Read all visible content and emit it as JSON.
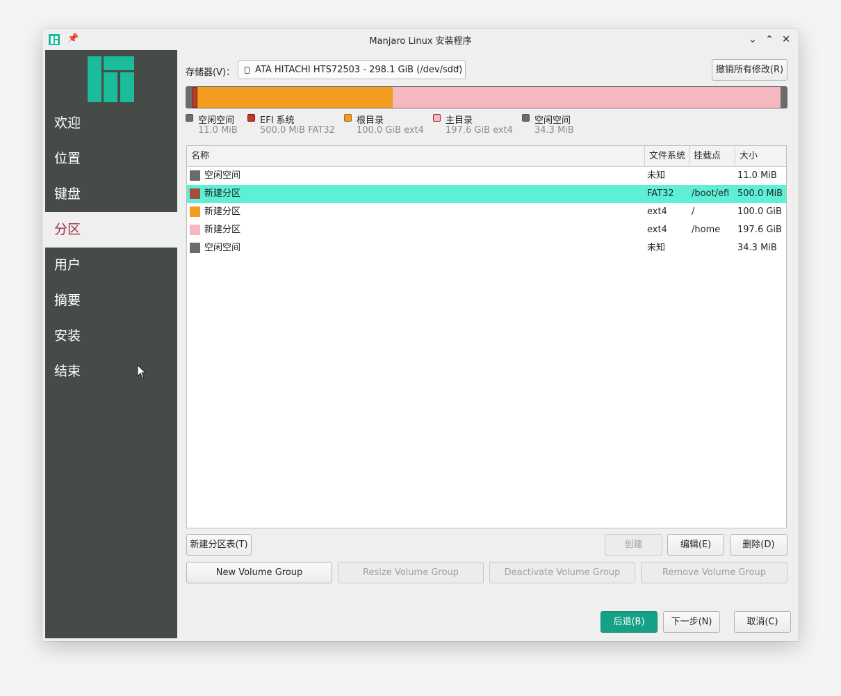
{
  "window": {
    "title": "Manjaro Linux 安装程序",
    "pin_icon": "pin-icon",
    "controls": [
      "minimize-icon",
      "maximize-icon",
      "close-icon"
    ]
  },
  "sidebar": {
    "items": [
      {
        "label": "欢迎"
      },
      {
        "label": "位置"
      },
      {
        "label": "键盘"
      },
      {
        "label": "分区",
        "active": true
      },
      {
        "label": "用户"
      },
      {
        "label": "摘要"
      },
      {
        "label": "安装"
      },
      {
        "label": "结束"
      }
    ]
  },
  "storage": {
    "label": "存储器(V)：",
    "device": "ATA HITACHI HTS72503 - 298.1 GiB (/dev/sdd)",
    "revert_button": "撤销所有修改(R)"
  },
  "legend": [
    {
      "name": "空闲空间",
      "size": "11.0 MiB",
      "fs": "",
      "color": "#6b6b6b"
    },
    {
      "name": "EFI 系统",
      "size": "500.0 MiB",
      "fs": "FAT32",
      "color": "#c0392b"
    },
    {
      "name": "根目录",
      "size": "100.0 GiB",
      "fs": "ext4",
      "color": "#f39c1f"
    },
    {
      "name": "主目录",
      "size": "197.6 GiB",
      "fs": "ext4",
      "color": "#f5b8bf"
    },
    {
      "name": "空闲空间",
      "size": "34.3 MiB",
      "fs": "",
      "color": "#6b6b6b"
    }
  ],
  "table": {
    "headers": {
      "name": "名称",
      "fs": "文件系统",
      "mount": "挂载点",
      "size": "大小"
    },
    "rows": [
      {
        "name": "空闲空间",
        "fs": "未知",
        "mount": "",
        "size": "11.0 MiB",
        "color": "#6b6b6b"
      },
      {
        "name": "新建分区",
        "fs": "FAT32",
        "mount": "/boot/efi",
        "size": "500.0 MiB",
        "color": "#a0503c",
        "selected": true
      },
      {
        "name": "新建分区",
        "fs": "ext4",
        "mount": "/",
        "size": "100.0 GiB",
        "color": "#f39c1f"
      },
      {
        "name": "新建分区",
        "fs": "ext4",
        "mount": "/home",
        "size": "197.6 GiB",
        "color": "#f5b8bf"
      },
      {
        "name": "空闲空间",
        "fs": "未知",
        "mount": "",
        "size": "34.3 MiB",
        "color": "#6b6b6b"
      }
    ]
  },
  "buttons": {
    "new_table": "新建分区表(T)",
    "create": "创建",
    "edit": "编辑(E)",
    "delete": "删除(D)",
    "new_vg": "New Volume Group",
    "resize_vg": "Resize Volume Group",
    "deactivate_vg": "Deactivate Volume Group",
    "remove_vg": "Remove Volume Group",
    "back": "后退(B)",
    "next": "下一步(N)",
    "cancel": "取消(C)"
  },
  "colors": {
    "accent": "#16a085",
    "sidebar": "#464b48",
    "selection": "#5ef0d6",
    "active_nav": "#a0304a"
  }
}
